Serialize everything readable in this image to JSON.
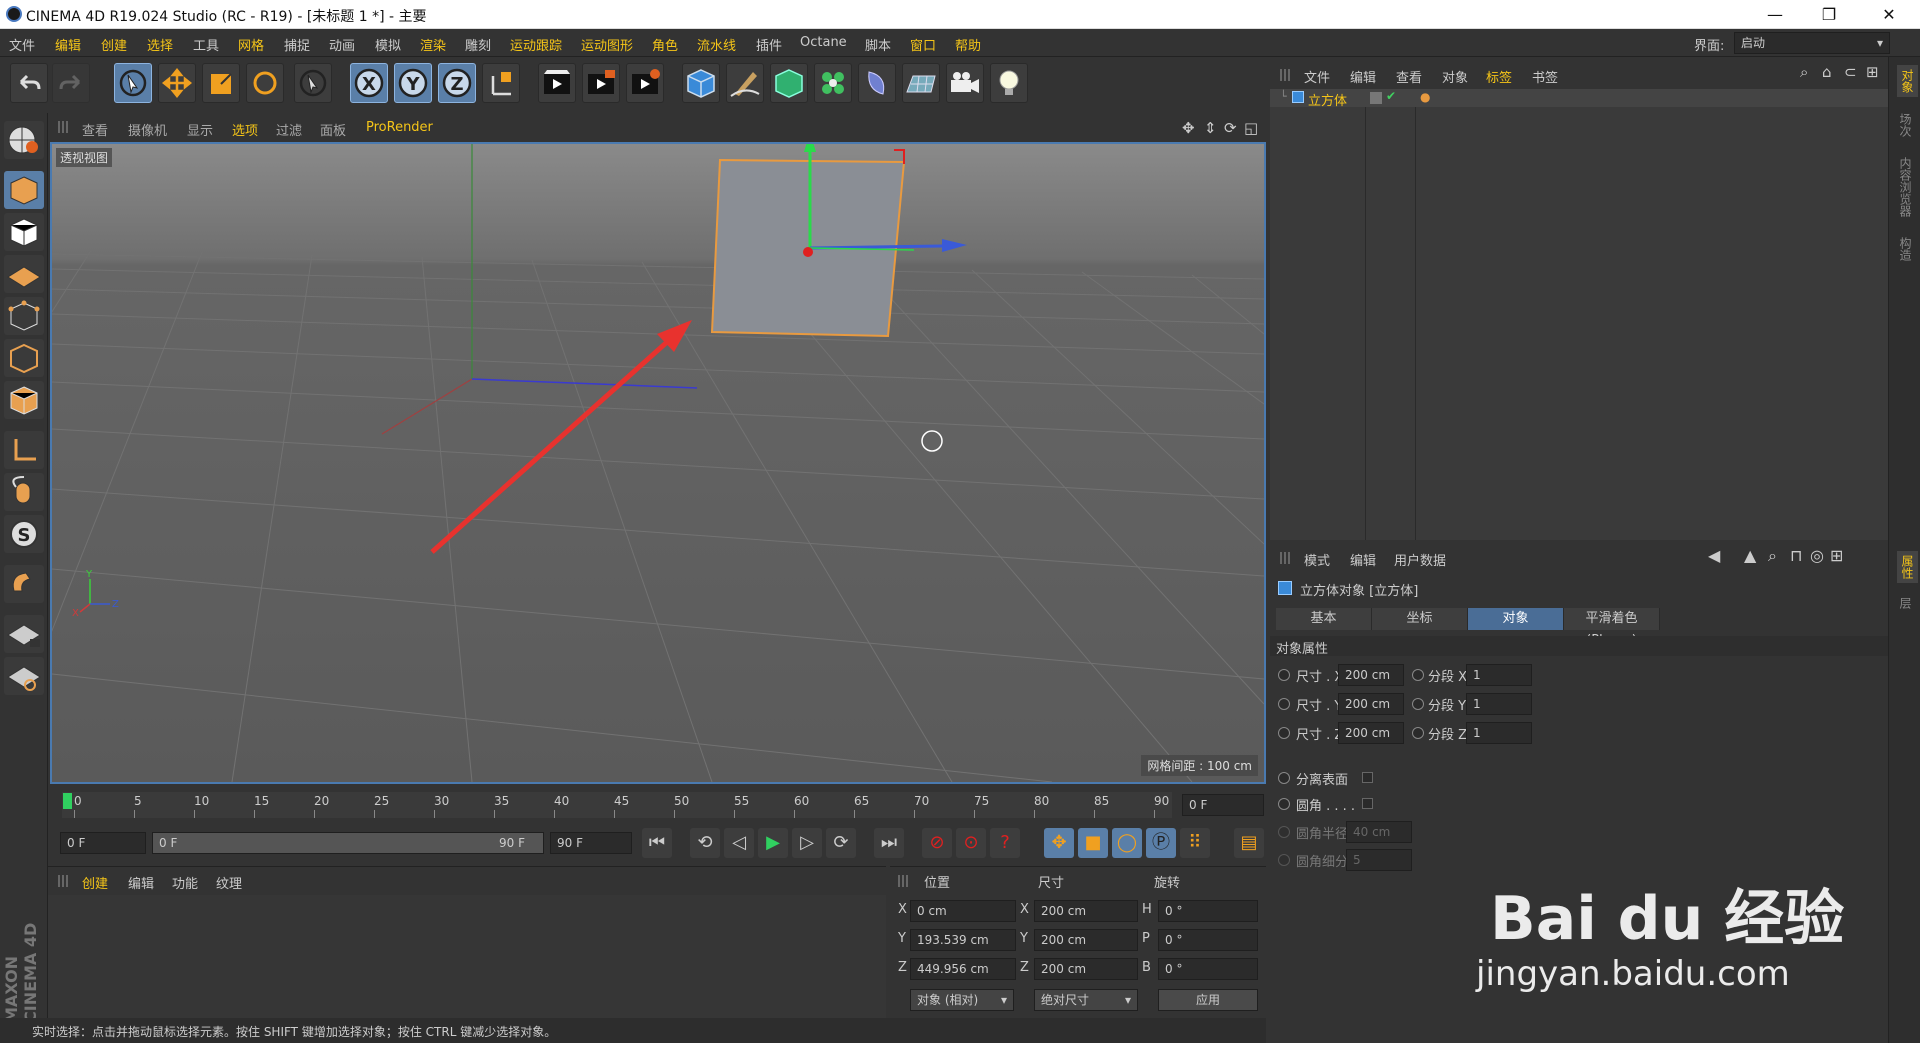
{
  "window": {
    "title": "CINEMA 4D R19.024 Studio (RC - R19) - [未标题 1 *] - 主要",
    "controls": [
      "—",
      "❐",
      "✕"
    ]
  },
  "menu": {
    "items": [
      "文件",
      "编辑",
      "创建",
      "选择",
      "工具",
      "网格",
      "捕捉",
      "动画",
      "模拟",
      "渲染",
      "雕刻",
      "运动跟踪",
      "运动图形",
      "角色",
      "流水线",
      "插件",
      "Octane",
      "脚本",
      "窗口",
      "帮助"
    ],
    "layout_label": "界面:",
    "layout_value": "启动"
  },
  "toolbar": {
    "icons": [
      "undo-icon",
      "redo-icon",
      "live-select-icon",
      "move-icon",
      "scale-icon",
      "rotate-icon",
      "last-tool-icon",
      "x-axis-icon",
      "y-axis-icon",
      "z-axis-icon",
      "coordinate-system-icon",
      "render-view-icon",
      "render-picture-viewer-icon",
      "render-settings-icon",
      "cube-icon",
      "pen-icon",
      "subdivision-icon",
      "cloner-icon",
      "deformer-icon",
      "floor-icon",
      "camera-icon",
      "light-icon"
    ]
  },
  "viewport": {
    "menu": [
      "查看",
      "摄像机",
      "显示",
      "选项",
      "过滤",
      "面板",
      "ProRender"
    ],
    "label": "透视视图",
    "grid_info": "网格间距 : 100 cm",
    "axis_labels": {
      "y": "Y",
      "z": "Z",
      "x": "X"
    }
  },
  "timeline": {
    "ticks": [
      "0",
      "5",
      "10",
      "15",
      "20",
      "25",
      "30",
      "35",
      "40",
      "45",
      "50",
      "55",
      "60",
      "65",
      "70",
      "75",
      "80",
      "85",
      "90"
    ],
    "current_frame": "0 F",
    "start_field": "0 F",
    "range_start": "0 F",
    "range_end": "90 F",
    "end_field": "90 F"
  },
  "material_manager": {
    "menu": [
      "创建",
      "编辑",
      "功能",
      "纹理"
    ]
  },
  "coord_manager": {
    "headers": [
      "位置",
      "尺寸",
      "旋转"
    ],
    "rows": [
      {
        "axis": "X",
        "pos": "0 cm",
        "size_axis": "X",
        "size": "200 cm",
        "rot_axis": "H",
        "rot": "0 °"
      },
      {
        "axis": "Y",
        "pos": "193.539 cm",
        "size_axis": "Y",
        "size": "200 cm",
        "rot_axis": "P",
        "rot": "0 °"
      },
      {
        "axis": "Z",
        "pos": "449.956 cm",
        "size_axis": "Z",
        "size": "200 cm",
        "rot_axis": "B",
        "rot": "0 °"
      }
    ],
    "mode_dropdown": "对象 (相对)",
    "size_dropdown": "绝对尺寸",
    "apply_button": "应用"
  },
  "status_bar": {
    "text": "实时选择：点击并拖动鼠标选择元素。按住 SHIFT 键增加选择对象；按住 CTRL 键减少选择对象。"
  },
  "object_manager": {
    "menu": [
      "文件",
      "编辑",
      "查看",
      "对象",
      "标签",
      "书签"
    ],
    "objects": [
      {
        "name": "立方体"
      }
    ]
  },
  "attribute_manager": {
    "menu": [
      "模式",
      "编辑",
      "用户数据"
    ],
    "title": "立方体对象 [立方体]",
    "tabs": [
      "基本",
      "坐标",
      "对象",
      "平滑着色(Phong)"
    ],
    "active_tab": "对象",
    "section": "对象属性",
    "size_rows": [
      {
        "label": "尺寸 . X",
        "value": "200 cm",
        "seg_label": "分段 X",
        "seg": "1"
      },
      {
        "label": "尺寸 . Y",
        "value": "200 cm",
        "seg_label": "分段 Y",
        "seg": "1"
      },
      {
        "label": "尺寸 . Z",
        "value": "200 cm",
        "seg_label": "分段 Z",
        "seg": "1"
      }
    ],
    "separate_surfaces": "分离表面",
    "fillet": "圆角 . . . .",
    "fillet_radius_label": "圆角半径",
    "fillet_radius": "40 cm",
    "fillet_subdiv_label": "圆角细分",
    "fillet_subdiv": "5"
  },
  "right_sidebar": {
    "tabs_top": [
      "对象",
      "场次",
      "内容浏览器",
      "构造"
    ],
    "tabs_bottom": [
      "属性",
      "层"
    ]
  },
  "brand": {
    "vertical": "MAXON CINEMA 4D"
  },
  "watermark": {
    "logo": "Bai du 经验",
    "url": "jingyan.baidu.com"
  },
  "colors": {
    "accent": "#f5c518",
    "selection_blue": "#4a6d96",
    "arrow_red": "#e8322e"
  }
}
